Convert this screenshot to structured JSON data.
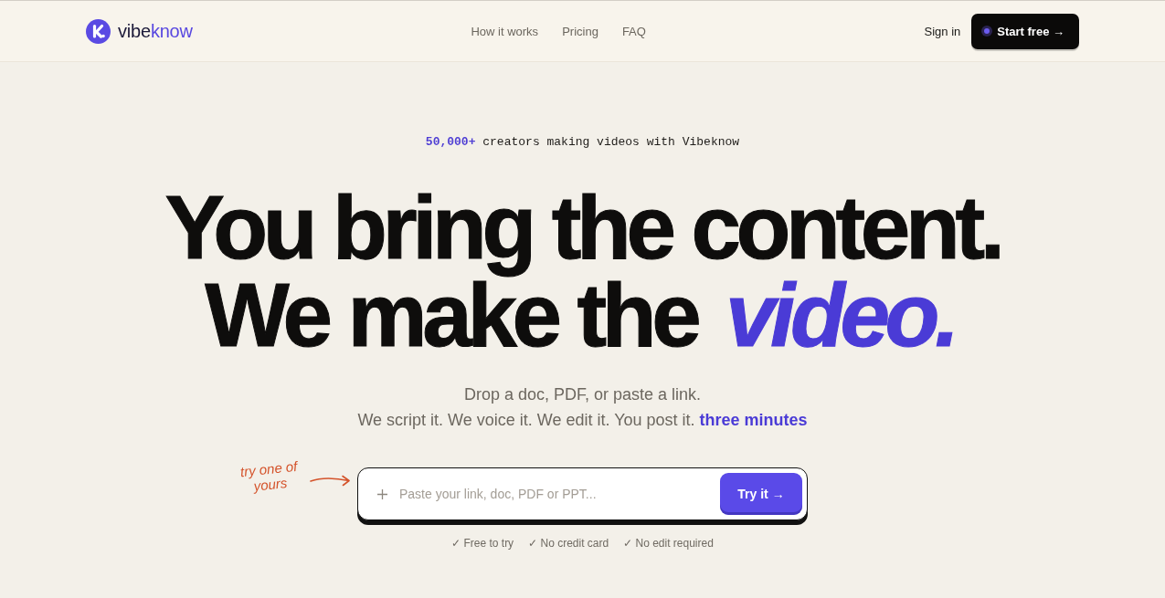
{
  "header": {
    "brand": {
      "name_start": "vibe",
      "name_accent": "know"
    },
    "nav": [
      "How it works",
      "Pricing",
      "FAQ"
    ],
    "sign_in": "Sign in",
    "cta": "Start free →"
  },
  "hero": {
    "tagline": "**50,000+** creators making videos with Vibeknow",
    "headline": [
      "You bring the content.",
      "We make the *video.*"
    ],
    "subtitle": [
      "Drop a doc, PDF, or paste a link.",
      "We script it. We voice it. We edit it. You post it. **three minutes**"
    ],
    "note": "try one of yours",
    "input": {
      "placeholder": "Paste your link, doc, PDF or PPT..."
    },
    "submit": "Try it →",
    "perks": [
      "✓ Free to try",
      "✓ No credit card",
      "✓ No edit required"
    ]
  }
}
